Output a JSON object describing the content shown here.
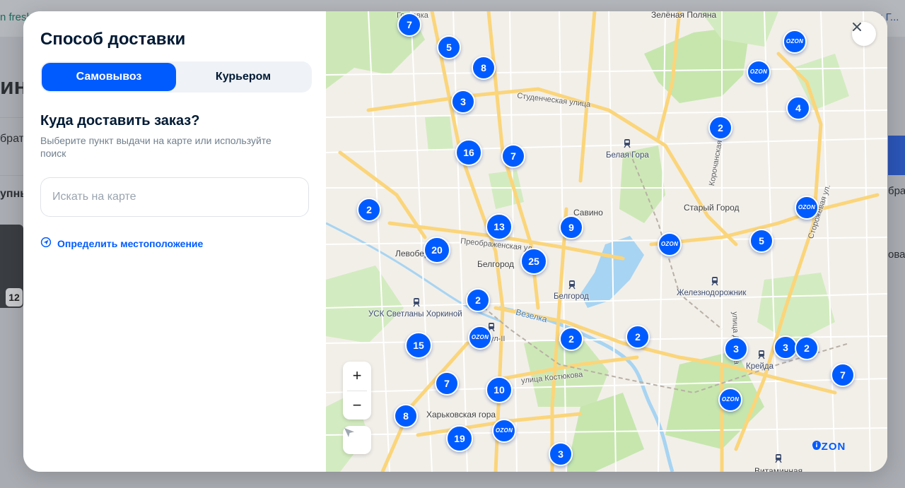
{
  "background": {
    "top_left_text": "n fresh",
    "top_right_text": "ая Г...",
    "big_text": "ин",
    "small_text_1": "брат",
    "small_text_2": "упны",
    "badge": "12",
    "right_text_1": "брат",
    "right_text_2": "овар"
  },
  "panel": {
    "title": "Способ доставки",
    "tabs": [
      "Самовывоз",
      "Курьером"
    ],
    "section_title": "Куда доставить заказ?",
    "section_sub": "Выберите пункт выдачи на карте или используйте поиск",
    "search_placeholder": "Искать на карте",
    "locate_label": "Определить местоположение"
  },
  "map": {
    "brand": "OZON",
    "ozon_pin_label": "OZON",
    "zoom_in": "+",
    "zoom_out": "−",
    "colors": {
      "accent": "#005bff",
      "road": "#fbd57a",
      "park": "#c9e7b4",
      "water": "#a7d4f2"
    },
    "clusters": [
      "7",
      "5",
      "8",
      "3",
      "16",
      "7",
      "2",
      "13",
      "9",
      "20",
      "25",
      "2",
      "15",
      "2",
      "2",
      "7",
      "10",
      "8",
      "19",
      "3",
      "2",
      "4",
      "5",
      "3",
      "3",
      "2",
      "7"
    ],
    "labels": [
      "Зелёная Поляна",
      "Студенческая улица",
      "Белая Гора",
      "Савино",
      "Старый Город",
      "Преображенская ул.",
      "Левобер.",
      "Белгород",
      "Белгород",
      "Железнодорожник",
      "УСК Светланы Хоркиной",
      "Везелка",
      "ул-II",
      "улица Костюкова",
      "Харьковская гора",
      "Крейда",
      "улица Дагаева",
      "Сторожевая ул.",
      "Корочанская ул.",
      "Витаминная",
      "Гостевка"
    ]
  }
}
